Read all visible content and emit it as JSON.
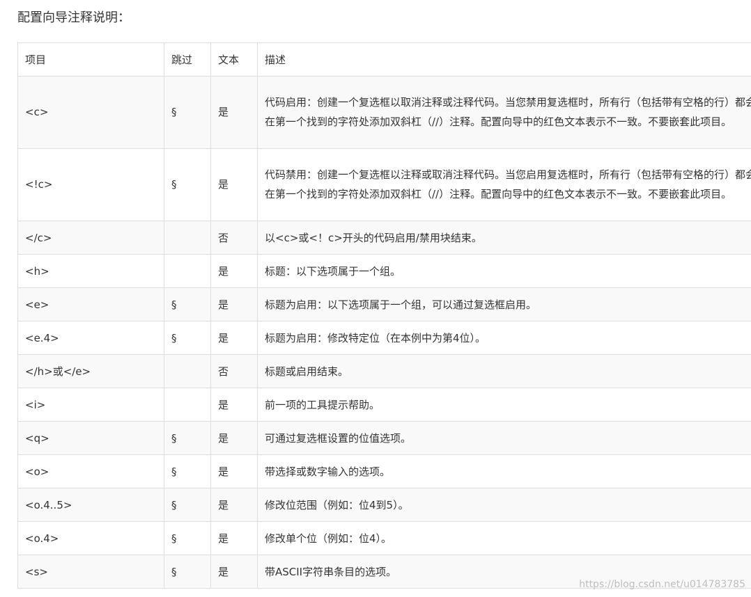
{
  "heading": "配置向导注释说明：",
  "columns": [
    "项目",
    "跳过",
    "文本",
    "描述"
  ],
  "rows": [
    {
      "item": "<c>",
      "skip": "§",
      "text": "是",
      "desc": "代码启用：创建一个复选框以取消注释或注释代码。当您禁用复选框时，所有行（包括带有空格的行）都会在第一个找到的字符处添加双斜杠（//）注释。配置向导中的红色文本表示不一致。不要嵌套此项目。"
    },
    {
      "item": "<!c>",
      "skip": "§",
      "text": "是",
      "desc": "代码禁用：创建一个复选框以注释或取消注释代码。当您启用复选框时，所有行（包括带有空格的行）都会在第一个找到的字符处添加双斜杠（//）注释。配置向导中的红色文本表示不一致。不要嵌套此项目。"
    },
    {
      "item": "</c>",
      "skip": "",
      "text": "否",
      "desc": "以<c>或<！c>开头的代码启用/禁用块结束。"
    },
    {
      "item": "<h>",
      "skip": "",
      "text": "是",
      "desc": "标题：以下选项属于一个组。"
    },
    {
      "item": "<e>",
      "skip": "§",
      "text": "是",
      "desc": "标题为启用：以下选项属于一个组，可以通过复选框启用。"
    },
    {
      "item": "<e.4>",
      "skip": "§",
      "text": "是",
      "desc": "标题为启用：修改特定位（在本例中为第4位）。"
    },
    {
      "item": "</h>或</e>",
      "skip": "",
      "text": "否",
      "desc": "标题或启用结束。"
    },
    {
      "item": "<i>",
      "skip": "",
      "text": "是",
      "desc": "前一项的工具提示帮助。"
    },
    {
      "item": "<q>",
      "skip": "§",
      "text": "是",
      "desc": "可通过复选框设置的位值选项。"
    },
    {
      "item": "<o>",
      "skip": "§",
      "text": "是",
      "desc": "带选择或数字输入的选项。"
    },
    {
      "item": "<o.4..5>",
      "skip": "§",
      "text": "是",
      "desc": "修改位范围（例如：位4到5）。"
    },
    {
      "item": "<o.4>",
      "skip": "§",
      "text": "是",
      "desc": "修改单个位（例如：位4）。"
    },
    {
      "item": "<s>",
      "skip": "§",
      "text": "是",
      "desc": "带ASCII字符串条目的选项。"
    }
  ],
  "watermark": "https://blog.csdn.net/u014783785"
}
